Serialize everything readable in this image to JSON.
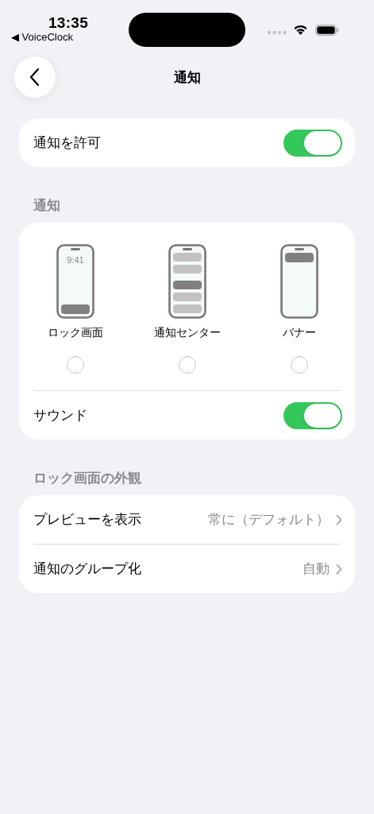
{
  "status_bar": {
    "time": "13:35",
    "back_app": "◀ VoiceClock"
  },
  "nav": {
    "title": "通知"
  },
  "allow": {
    "label": "通知を許可",
    "on": true
  },
  "notifications": {
    "header": "通知",
    "styles": [
      {
        "kind": "lock",
        "label": "ロック画面",
        "clock": "9:41",
        "selected": false
      },
      {
        "kind": "center",
        "label": "通知センター",
        "selected": false
      },
      {
        "kind": "banner",
        "label": "バナー",
        "selected": false
      }
    ],
    "sound": {
      "label": "サウンド",
      "on": true
    }
  },
  "appearance": {
    "header": "ロック画面の外観",
    "rows": [
      {
        "label": "プレビューを表示",
        "value": "常に（デフォルト）"
      },
      {
        "label": "通知のグループ化",
        "value": "自動"
      }
    ]
  }
}
